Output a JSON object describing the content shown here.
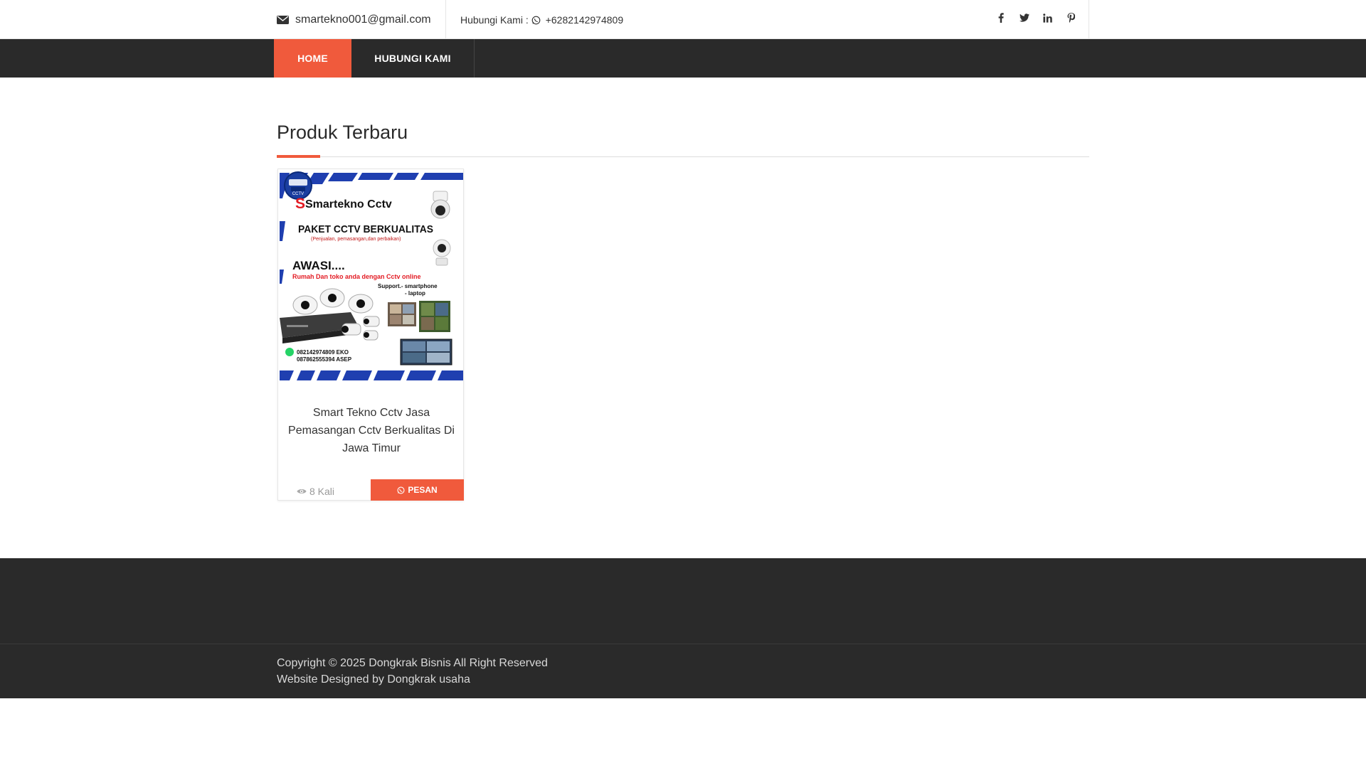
{
  "topbar": {
    "email": "smartekno001@gmail.com",
    "contact_label": "Hubungi Kami :",
    "phone": "+6282142974809",
    "social_icons": [
      "facebook-icon",
      "twitter-icon",
      "linkedin-icon",
      "pinterest-icon"
    ]
  },
  "nav": {
    "items": [
      {
        "label": "HOME",
        "active": true
      },
      {
        "label": "HUBUNGI KAMI",
        "active": false
      }
    ]
  },
  "section": {
    "title": "Produk Terbaru"
  },
  "product": {
    "image": {
      "brand": "Smartekno Cctv",
      "logo_label": "CCTV",
      "headline": "PAKET CCTV BERKUALITAS",
      "subheadline": "(Penjualan, pemasangan,dan perbaikan)",
      "warning": "AWASI....",
      "warning_sub": "Rumah Dan toko anda dengan Cctv online",
      "support": "Support.- smartphone",
      "support2": "- laptop",
      "phone1": "082142974809 EKO",
      "phone2": "087862555394 ASEP"
    },
    "title": "Smart Tekno Cctv Jasa Pemasangan Cctv Berkualitas Di Jawa Timur",
    "views": "8 Kali",
    "order_label": "PESAN"
  },
  "footer": {
    "copyright": "Copyright © 2025 Dongkrak Bisnis All Right Reserved",
    "designed_by": "Website Designed by Dongkrak usaha"
  },
  "colors": {
    "accent": "#f05a3c",
    "dark": "#2a2a2a",
    "brand_blue": "#1f3fb0"
  }
}
